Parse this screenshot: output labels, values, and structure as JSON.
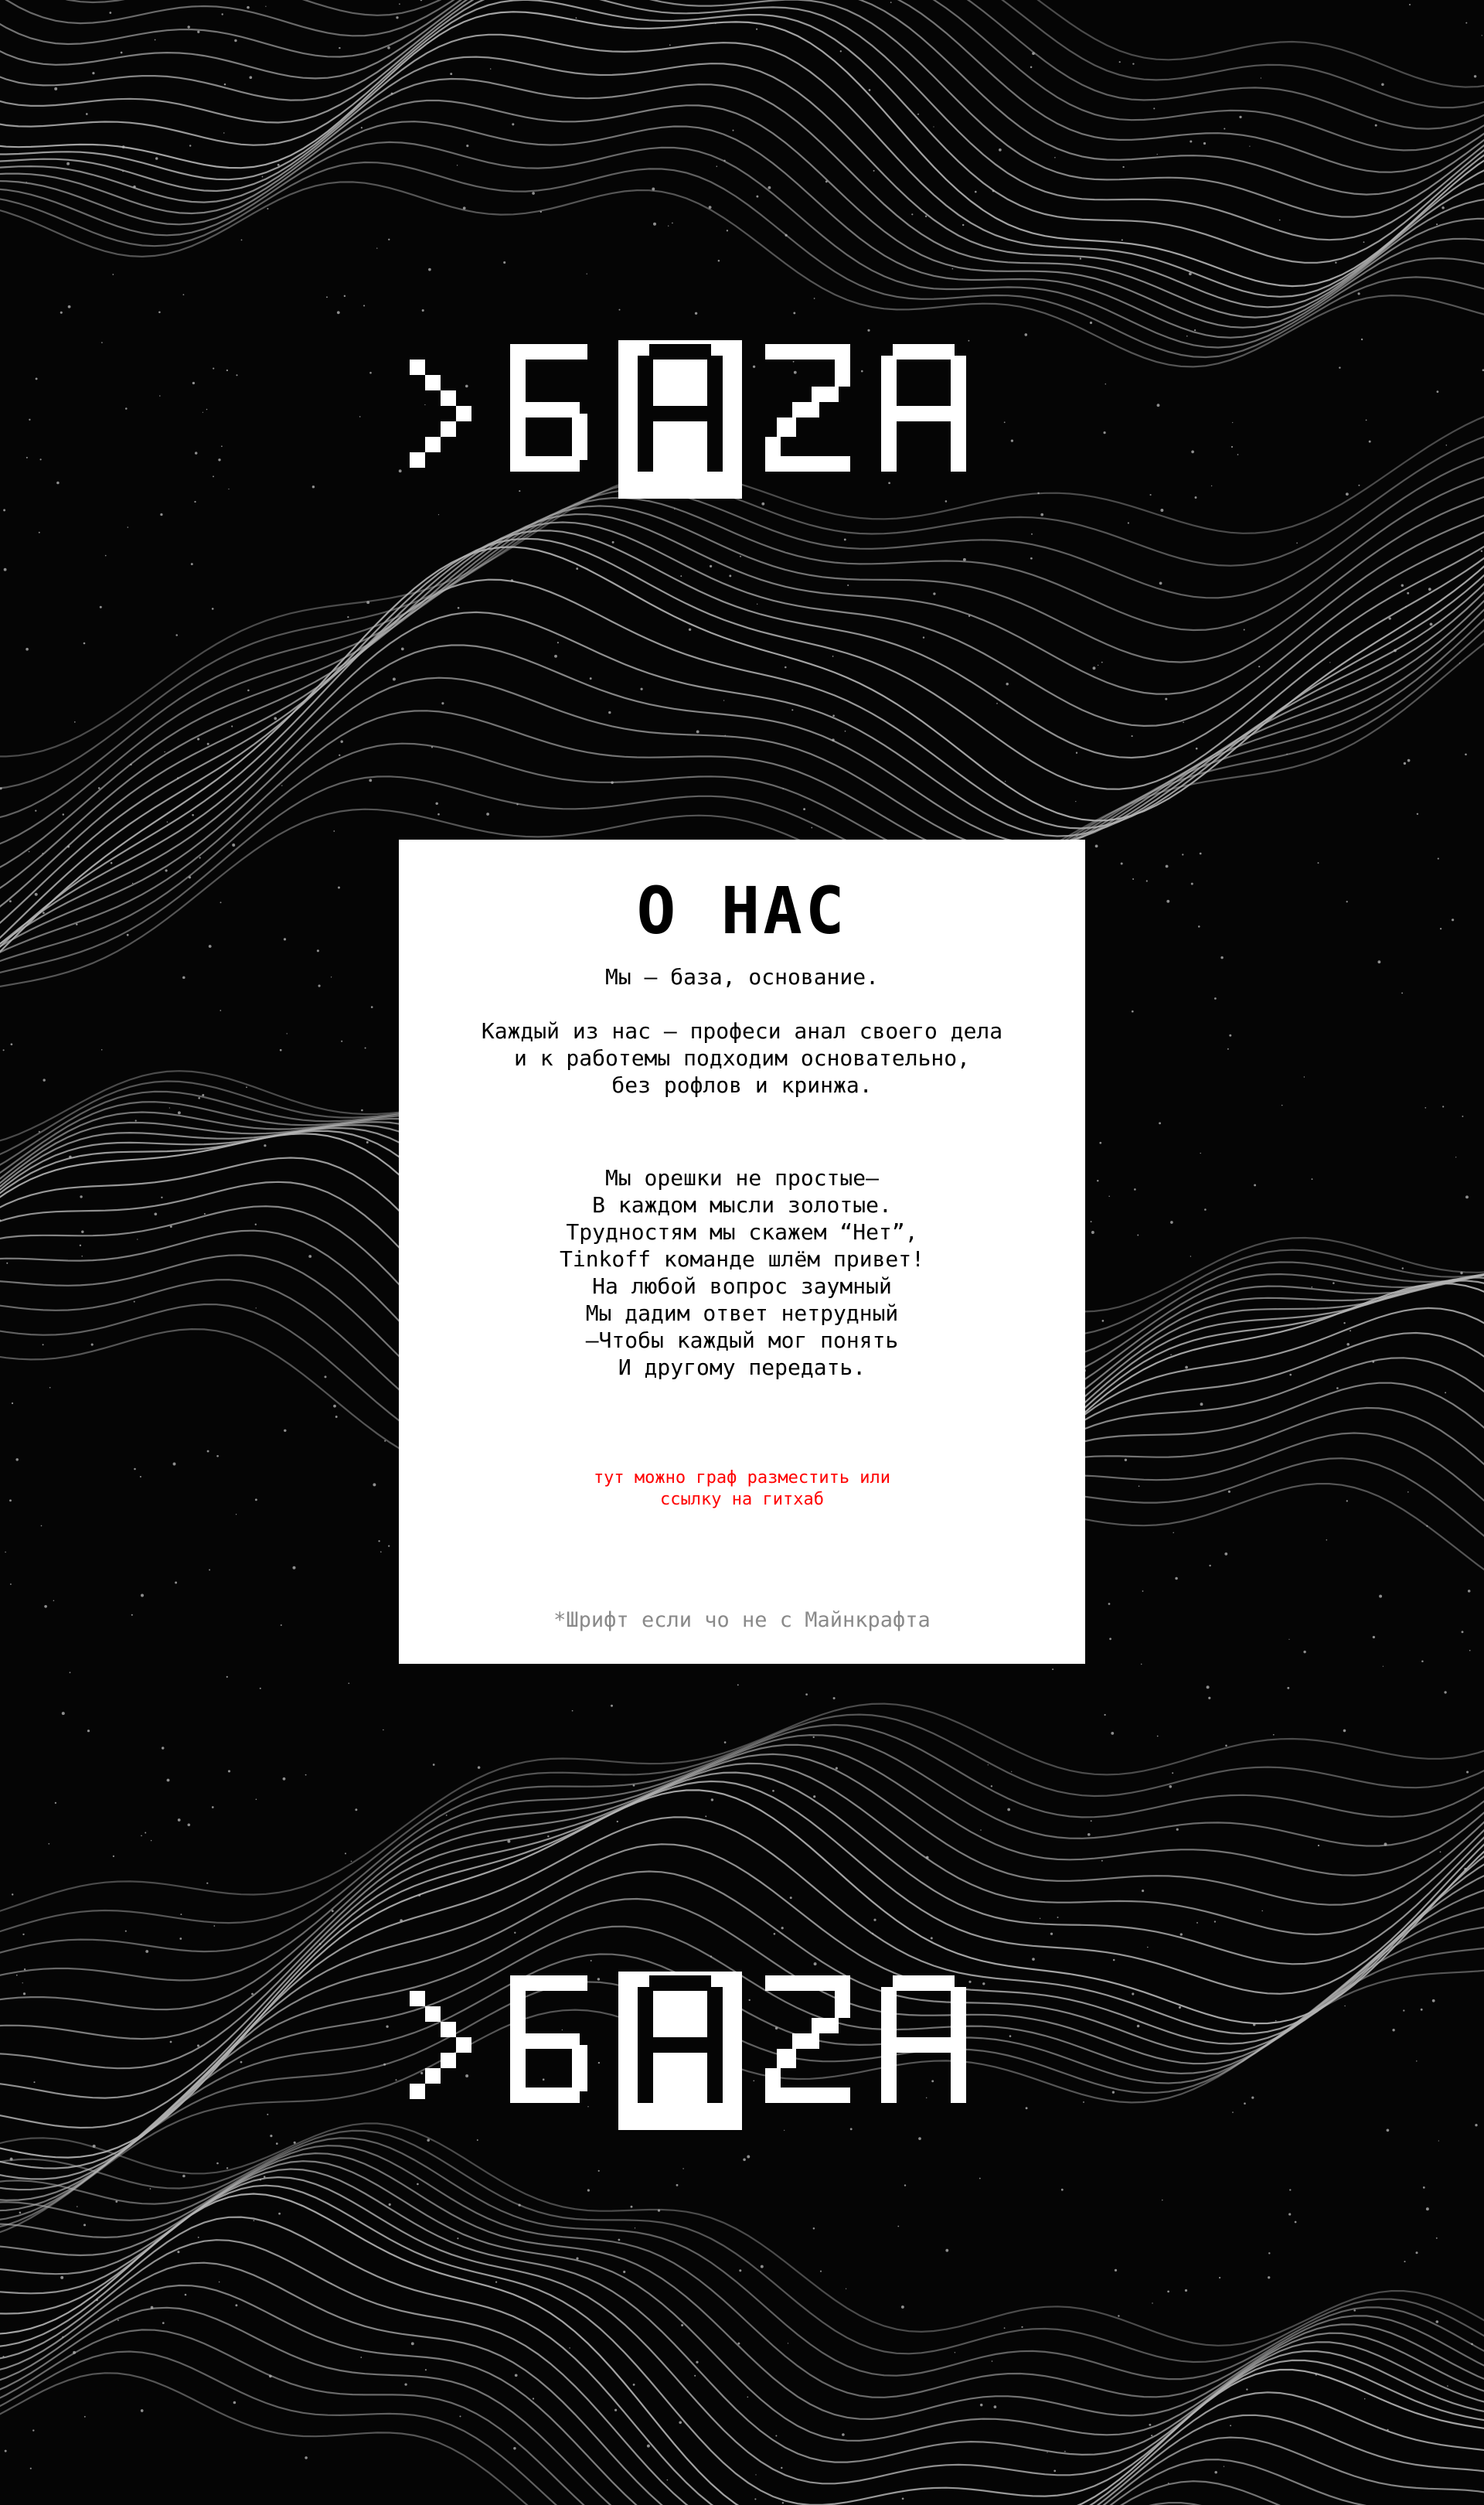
{
  "logo": {
    "text": ">БAZA",
    "glyphs": [
      ">",
      "Б",
      "A",
      "Z",
      "A"
    ],
    "highlighted_glyph": "A"
  },
  "about": {
    "title": "О НАС",
    "intro": "Мы – база, основание.\n\nКаждый из нас – професи анал своего дела\nи к работемы подходим основательно,\nбез рофлов и кринжа.",
    "poem": "Мы орешки не простые–\nВ каждом мысли золотые.\nТрудностям мы скажем “Нет”,\nTinkoff команде шлём привет!\nНа любой вопрос заумный\nМы дадим ответ нетрудный\n–Чтобы каждый мог понять\nИ другому передать.",
    "note": "тут можно граф разместить или\nссылку на гитхаб",
    "footnote": "*Шрифт если чо не с Майнкрафта"
  },
  "colors": {
    "background": "#050505",
    "card": "#ffffff",
    "contour_lines": "#b5b5b5",
    "note_text": "#ff0000",
    "footnote_text": "#8a8a8a"
  }
}
